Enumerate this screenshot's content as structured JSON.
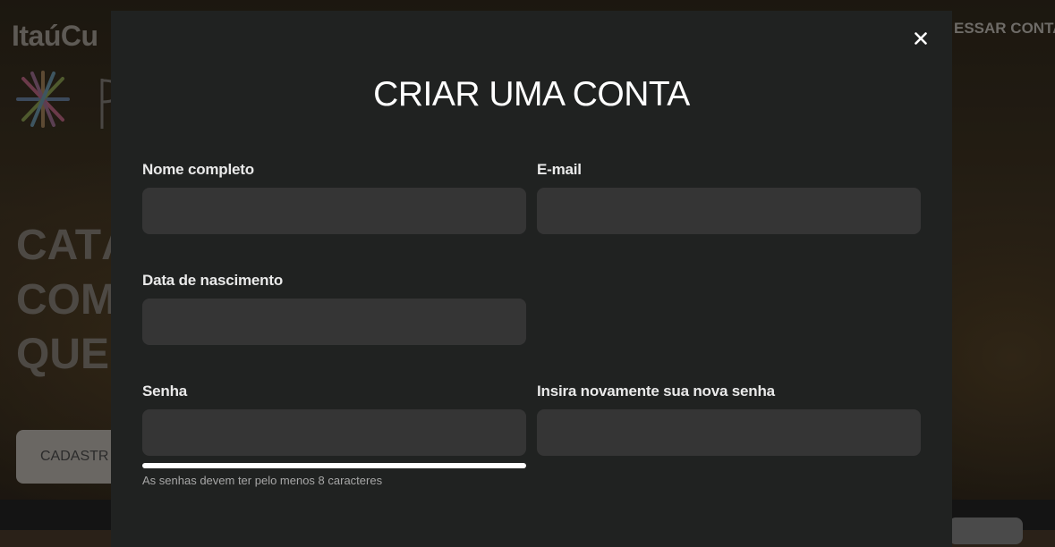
{
  "background_page": {
    "brand_text": "ItaúCu",
    "header_link": "ESSAR CONTA",
    "hero_lines": [
      "CATÁ",
      "COM",
      "QUE"
    ],
    "cta_label": "CADASTR"
  },
  "modal": {
    "title": "CRIAR UMA CONTA",
    "close_icon": "close-icon",
    "fields": {
      "full_name": {
        "label": "Nome completo",
        "value": "",
        "placeholder": ""
      },
      "email": {
        "label": "E-mail",
        "value": "",
        "placeholder": ""
      },
      "birth_date": {
        "label": "Data de nascimento",
        "value": "",
        "placeholder": ""
      },
      "password": {
        "label": "Senha",
        "value": "",
        "placeholder": ""
      },
      "password_confirm": {
        "label": "Insira novamente sua nova senha",
        "value": "",
        "placeholder": ""
      }
    },
    "password_strength": {
      "fill_fraction": 1.0
    },
    "password_hint": "As senhas devem ter pelo menos 8 caracteres"
  },
  "colors": {
    "modal_background": "#202221",
    "input_background": "#353535",
    "title": "#ffffff",
    "strength_bar": "#ffffff"
  }
}
